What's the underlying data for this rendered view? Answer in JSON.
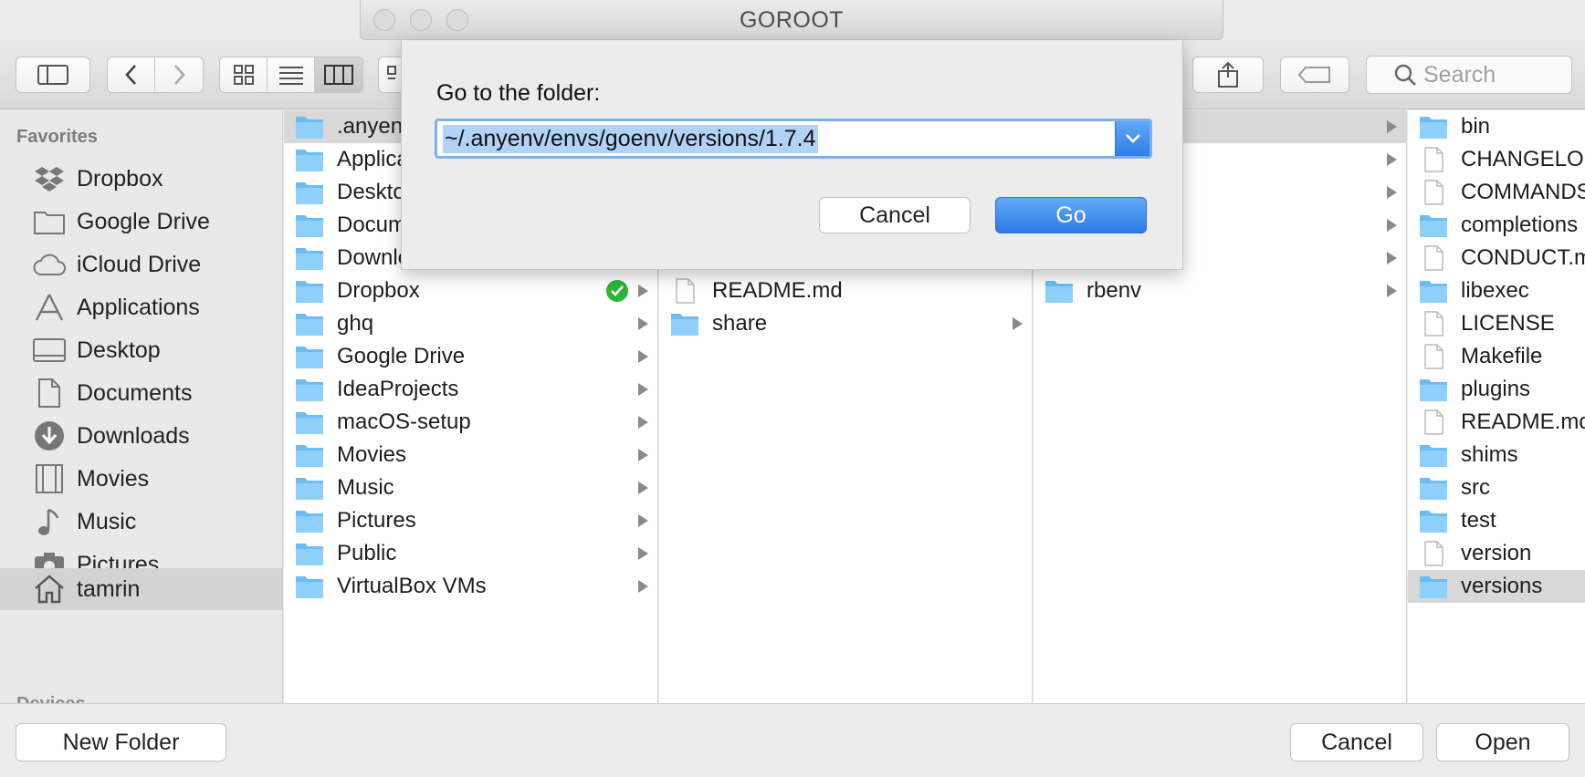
{
  "window": {
    "title": "GOROOT"
  },
  "toolbar": {
    "search_placeholder": "Search"
  },
  "sidebar": {
    "heading": "Favorites",
    "items": [
      {
        "label": "Dropbox",
        "icon": "dropbox-icon"
      },
      {
        "label": "Google Drive",
        "icon": "folder-icon"
      },
      {
        "label": "iCloud Drive",
        "icon": "cloud-icon"
      },
      {
        "label": "Applications",
        "icon": "applications-icon"
      },
      {
        "label": "Desktop",
        "icon": "desktop-icon"
      },
      {
        "label": "Documents",
        "icon": "documents-icon"
      },
      {
        "label": "Downloads",
        "icon": "downloads-icon"
      },
      {
        "label": "Movies",
        "icon": "movies-icon"
      },
      {
        "label": "Music",
        "icon": "music-icon"
      },
      {
        "label": "Pictures",
        "icon": "pictures-icon"
      },
      {
        "label": "tamrin",
        "icon": "home-icon",
        "selected": true
      }
    ],
    "cut_heading": "Devices"
  },
  "columns": {
    "col1": [
      {
        "name": ".anyenv",
        "kind": "folder",
        "selected": true
      },
      {
        "name": "Applications",
        "kind": "folder"
      },
      {
        "name": "Desktop",
        "kind": "folder"
      },
      {
        "name": "Documents",
        "kind": "folder"
      },
      {
        "name": "Downloads",
        "kind": "folder"
      },
      {
        "name": "Dropbox",
        "kind": "folder",
        "badge": true,
        "arrow": true
      },
      {
        "name": "ghq",
        "kind": "folder",
        "arrow": true
      },
      {
        "name": "Google Drive",
        "kind": "folder",
        "arrow": true
      },
      {
        "name": "IdeaProjects",
        "kind": "folder",
        "arrow": true
      },
      {
        "name": "macOS-setup",
        "kind": "folder",
        "arrow": true
      },
      {
        "name": "Movies",
        "kind": "folder",
        "arrow": true
      },
      {
        "name": "Music",
        "kind": "folder",
        "arrow": true
      },
      {
        "name": "Pictures",
        "kind": "folder",
        "arrow": true
      },
      {
        "name": "Public",
        "kind": "folder",
        "arrow": true
      },
      {
        "name": "VirtualBox VMs",
        "kind": "folder",
        "arrow": true
      }
    ],
    "col2": [
      {
        "name": "README.md",
        "kind": "file"
      },
      {
        "name": "share",
        "kind": "folder",
        "arrow": true
      }
    ],
    "col3": [
      {
        "name": "rbenv",
        "kind": "folder",
        "arrow": true
      }
    ],
    "col4": [
      {
        "name": "bin",
        "kind": "folder"
      },
      {
        "name": "CHANGELOG",
        "kind": "file"
      },
      {
        "name": "COMMANDS",
        "kind": "file"
      },
      {
        "name": "completions",
        "kind": "folder"
      },
      {
        "name": "CONDUCT.m",
        "kind": "file"
      },
      {
        "name": "libexec",
        "kind": "folder"
      },
      {
        "name": "LICENSE",
        "kind": "file"
      },
      {
        "name": "Makefile",
        "kind": "file"
      },
      {
        "name": "plugins",
        "kind": "folder"
      },
      {
        "name": "README.md",
        "kind": "file"
      },
      {
        "name": "shims",
        "kind": "folder"
      },
      {
        "name": "src",
        "kind": "folder"
      },
      {
        "name": "test",
        "kind": "folder"
      },
      {
        "name": "version",
        "kind": "file"
      },
      {
        "name": "versions",
        "kind": "folder",
        "selected": true
      }
    ]
  },
  "bottom": {
    "new_folder": "New Folder",
    "cancel": "Cancel",
    "open": "Open"
  },
  "sheet": {
    "label": "Go to the folder:",
    "path": "~/.anyenv/envs/goenv/versions/1.7.4",
    "cancel": "Cancel",
    "go": "Go"
  },
  "colors": {
    "accent": "#2c7ae6",
    "folder": "#6cbcf5",
    "selection_text": "#b2d3f7"
  }
}
